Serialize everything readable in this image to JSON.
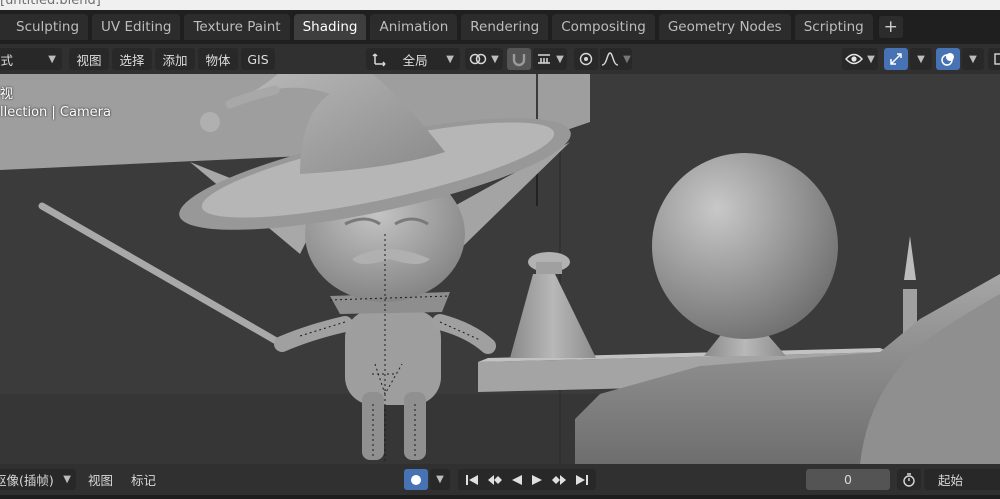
{
  "window": {
    "title": "[untitled.blend]"
  },
  "tabs": [
    {
      "label": "Sculpting",
      "active": false
    },
    {
      "label": "UV Editing",
      "active": false
    },
    {
      "label": "Texture Paint",
      "active": false
    },
    {
      "label": "Shading",
      "active": true
    },
    {
      "label": "Animation",
      "active": false
    },
    {
      "label": "Rendering",
      "active": false
    },
    {
      "label": "Compositing",
      "active": false
    },
    {
      "label": "Geometry Nodes",
      "active": false
    },
    {
      "label": "Scripting",
      "active": false
    }
  ],
  "tab_add_label": "+",
  "viewport_header": {
    "mode_label": "模式",
    "menus": [
      "视图",
      "选择",
      "添加",
      "物体",
      "GIS"
    ],
    "orientation_label": "全局"
  },
  "viewport": {
    "view_label": "视",
    "collection_label": "llection | Camera"
  },
  "timeline": {
    "keying_label": "抠像(插帧)",
    "view_label": "视图",
    "marker_label": "标记",
    "current_frame": "0",
    "start_label": "起始"
  },
  "colors": {
    "active_tab": "#3e3e3e",
    "accent_blue": "#4772b3",
    "viewport_bg": "#3b3b3b"
  }
}
